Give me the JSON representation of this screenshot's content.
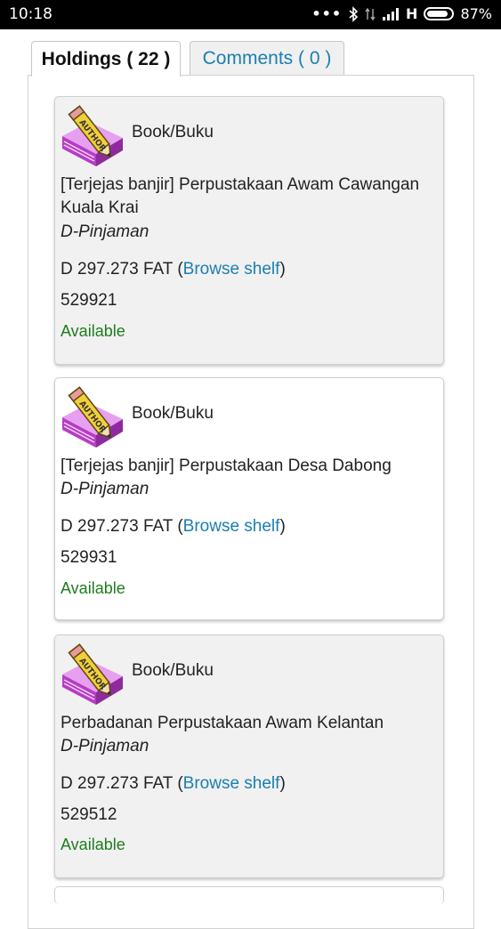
{
  "status_bar": {
    "time": "10:18",
    "network": "H",
    "battery": "87%"
  },
  "tabs": [
    {
      "label": "Holdings ( 22 )",
      "active": true
    },
    {
      "label": "Comments ( 0 )",
      "active": false
    }
  ],
  "holdings": [
    {
      "type": "Book/Buku",
      "library": "[Terjejas banjir] Perpustakaan Awam Cawangan Kuala Krai",
      "location": "D-Pinjaman",
      "call_number": "D 297.273 FAT",
      "browse_label": "Browse shelf",
      "barcode": "529921",
      "status": "Available"
    },
    {
      "type": "Book/Buku",
      "library": "[Terjejas banjir] Perpustakaan Desa Dabong",
      "location": "D-Pinjaman",
      "call_number": "D 297.273 FAT",
      "browse_label": "Browse shelf",
      "barcode": "529931",
      "status": "Available"
    },
    {
      "type": "Book/Buku",
      "library": "Perbadanan Perpustakaan Awam Kelantan",
      "location": "D-Pinjaman",
      "call_number": "D 297.273 FAT",
      "browse_label": "Browse shelf",
      "barcode": "529512",
      "status": "Available"
    }
  ],
  "colors": {
    "link": "#1a7fb0",
    "available": "#1e7d1e",
    "book_icon": "#c84fd6"
  },
  "icons": {
    "item_type": "book-author-pencil-icon"
  }
}
